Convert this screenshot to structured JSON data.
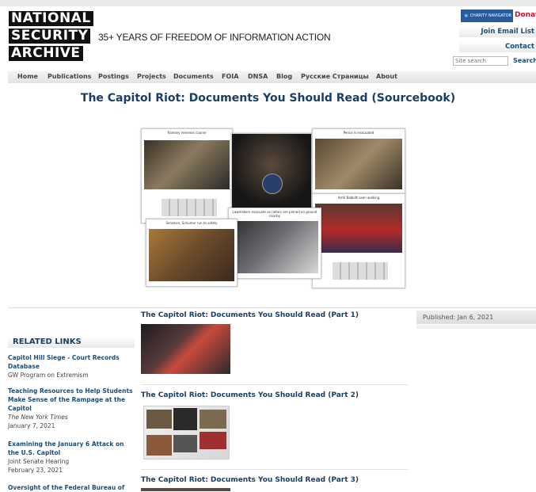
{
  "brand": {
    "logo_lines": [
      "NATIONAL",
      "SECURITY",
      "ARCHIVE"
    ],
    "tagline": "35+ YEARS OF FREEDOM OF INFORMATION ACTION"
  },
  "header": {
    "charity_badge": "CHARITY NAVIGATOR",
    "donate_label": "Donate",
    "join_email_label": "Join Email List",
    "contact_label": "Contact",
    "search_placeholder": "Site search",
    "search_button": "Search"
  },
  "nav": {
    "items": [
      "Home",
      "Publications",
      "Postings",
      "Projects",
      "Documents",
      "FOIA",
      "DNSA",
      "Blog",
      "Русские Страницы",
      "About"
    ]
  },
  "page": {
    "title": "The Capitol Riot: Documents You Should Read (Sourcebook)"
  },
  "hero_captions": [
    "Ramsey reverses course",
    "Pence is evacuated",
    "Ashli Babbitt seen walking",
    "Senators, Schumer run to safety",
    "Lawmakers evacuate as rioters are pinned on ground nearby"
  ],
  "related": {
    "heading": "RELATED LINKS",
    "links": [
      {
        "title": "Capitol Hill Siege - Court Records Database",
        "source": "GW Program on Extremism",
        "date": ""
      },
      {
        "title": "Teaching Resources to Help Students Make Sense of the Rampage at the Capitol",
        "source": "The New York Times",
        "date": "January 7, 2021"
      },
      {
        "title": "Examining the January 6 Attack on the U.S. Capitol",
        "source": "Joint Senate Hearing",
        "date": "February 23, 2021"
      },
      {
        "title": "Oversight of the Federal Bureau of",
        "source": "",
        "date": ""
      }
    ]
  },
  "posts": [
    {
      "title": "The Capitol Riot: Documents You Should Read (Part 1)"
    },
    {
      "title": "The Capitol Riot: Documents You Should Read (Part 2)"
    },
    {
      "title": "The Capitol Riot: Documents You Should Read (Part 3)"
    }
  ],
  "published_label": "Published: Jan 6, 2021",
  "colors": {
    "accent": "#1a3f66",
    "link": "#1a4e7a",
    "donate": "#c8102e"
  }
}
